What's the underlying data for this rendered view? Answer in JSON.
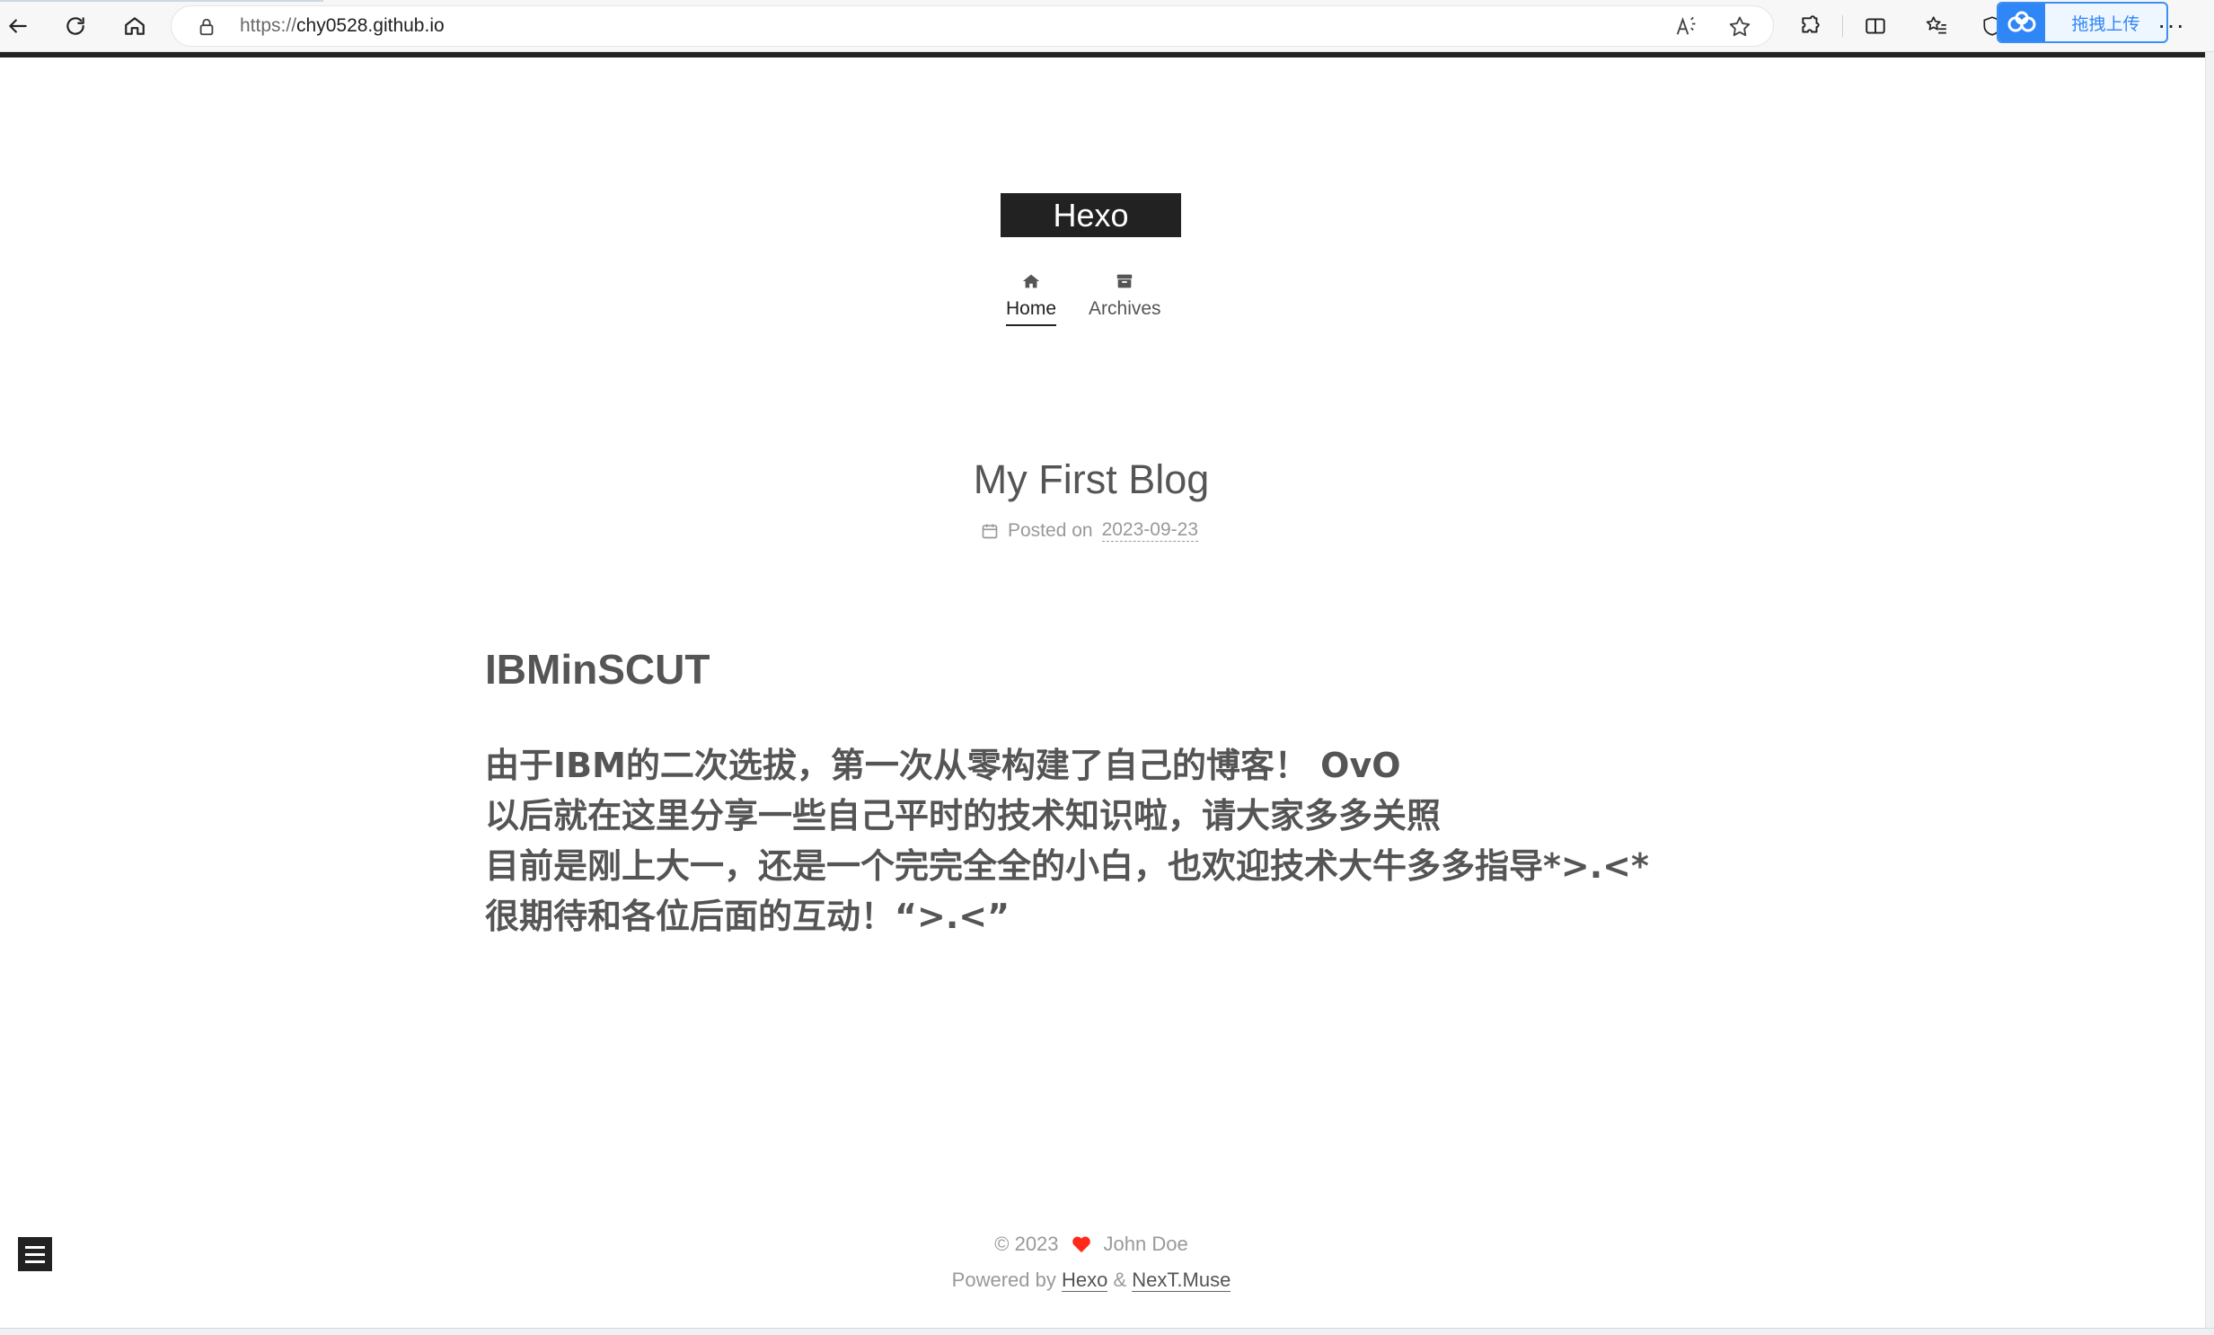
{
  "browser": {
    "url_protocol": "https://",
    "url_host": "chy0528.github.io",
    "upload_widget_label": "拖拽上传",
    "more_label": "···"
  },
  "site": {
    "title": "Hexo",
    "menu": [
      {
        "label": "Home",
        "icon": "home-icon",
        "active": true
      },
      {
        "label": "Archives",
        "icon": "archive-icon",
        "active": false
      }
    ]
  },
  "post": {
    "title": "My First Blog",
    "meta_prefix": "Posted on",
    "date": "2023-09-23",
    "heading": "IBMinSCUT",
    "lines": [
      "由于IBM的二次选拔，第一次从零构建了自己的博客！ OvO",
      "以后就在这里分享一些自己平时的技术知识啦，请大家多多关照",
      "目前是刚上大一，还是一个完完全全的小白，也欢迎技术大牛多多指导*>.<*",
      "很期待和各位后面的互动！“>.<”"
    ]
  },
  "footer": {
    "copyright": "© 2023",
    "author": "John Doe",
    "powered_by": "Powered by",
    "link_hexo": "Hexo",
    "amp": "&",
    "link_theme": "NexT.Muse"
  },
  "colors": {
    "accent": "#222222",
    "text": "#555555",
    "muted": "#999999",
    "heart": "#ff2a1a",
    "upload_blue": "#2f86f6"
  }
}
